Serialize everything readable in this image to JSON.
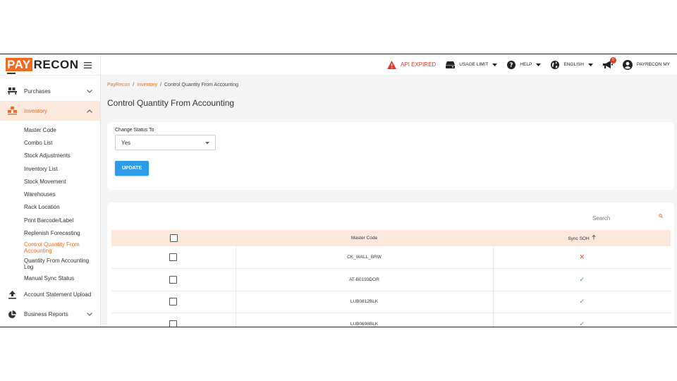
{
  "logo": {
    "pay": "PAY",
    "recon": "RECON"
  },
  "sidebar": {
    "purchases": "Purchases",
    "inventory": "Inventory",
    "sub_items": [
      "Master Code",
      "Combo List",
      "Stock Adjustments",
      "Inventory List",
      "Stock Movement",
      "Warehouses",
      "Rack Location",
      "Print Barcode/Label",
      "Replenish Forecasting",
      "Control Quantity From Accounting",
      "Quantity From Accounting Log",
      "Manual Sync Status"
    ],
    "account_statement": "Account Statement Upload",
    "business_reports": "Business Reports"
  },
  "topbar": {
    "api": "API EXPIRED",
    "usage": "USAGE LIMIT",
    "help": "HELP",
    "lang": "ENGLISH",
    "notif_count": "0",
    "user": "PAYRECON MY"
  },
  "breadcrumb": {
    "home": "PayRecon",
    "section": "Inventory",
    "current": "Control Quantity From Accounting"
  },
  "page_title": "Control Quantity From Accounting",
  "form": {
    "label": "Change Status To",
    "value": "Yes",
    "button": "UPDATE"
  },
  "table": {
    "search_placeholder": "Search",
    "headers": {
      "master_code": "Master Code",
      "sync_soh": "Sync SOH"
    },
    "rows": [
      {
        "code": "CK_WALL_BRW",
        "sync": "✕"
      },
      {
        "code": "AT-B0193DOR",
        "sync": "✓"
      },
      {
        "code": "LUB0812BLK",
        "sync": "✓"
      },
      {
        "code": "LUB0698BLK",
        "sync": "✓"
      }
    ]
  },
  "colors": {
    "brand": "#f26b21",
    "active_bg": "#fde9dc",
    "button": "#2e9ae8",
    "error": "#e23b2e",
    "success": "#3aa857"
  }
}
